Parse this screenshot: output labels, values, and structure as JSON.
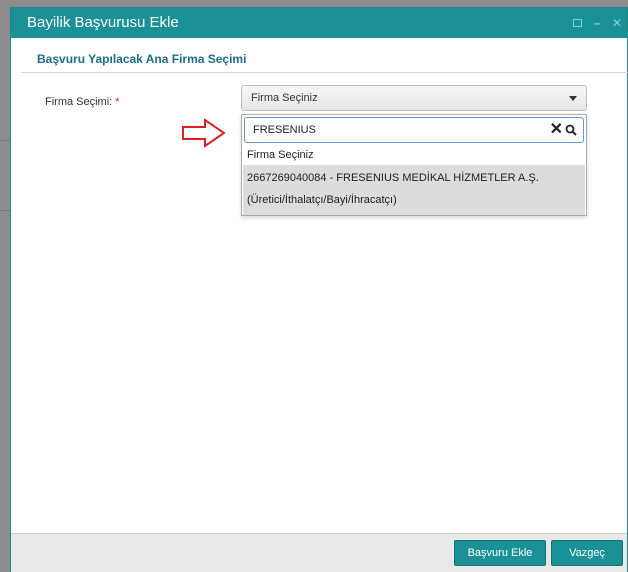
{
  "window": {
    "title": "Bayilik Başvurusu Ekle",
    "controls": [
      "maximize-icon",
      "minimize-icon",
      "close-icon"
    ]
  },
  "section": {
    "title": "Başvuru Yapılacak Ana Firma Seçimi"
  },
  "form": {
    "firma_label": "Firma Seçimi:",
    "required_mark": "*",
    "select_value": "Firma Seçiniz"
  },
  "dropdown": {
    "search_value": "FRESENIUS",
    "clear_symbol": "✕",
    "options": [
      {
        "label": "Firma Seçiniz"
      },
      {
        "line1": "2667269040084 - FRESENIUS MEDİKAL HİZMETLER A.Ş.",
        "line2": "(Üretici/İthalatçı/Bayi/İhracatçı)"
      }
    ]
  },
  "footer": {
    "add_label": "Başvuru Ekle",
    "cancel_label": "Vazgeç"
  },
  "colors": {
    "accent": "#1a9196",
    "section_title": "#1d6e8e",
    "required": "#d9232d",
    "annotation_arrow": "#e02020"
  }
}
